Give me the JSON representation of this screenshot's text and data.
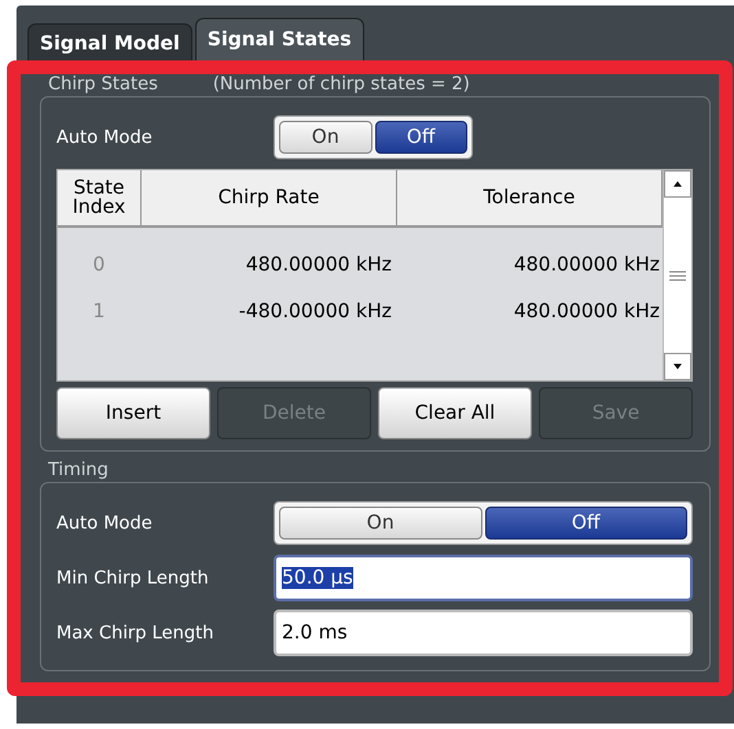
{
  "tabs": [
    {
      "label": "Signal Model",
      "selected": false
    },
    {
      "label": "Signal States",
      "selected": true
    }
  ],
  "chirp_states": {
    "title": "Chirp States",
    "count_label": "(Number of chirp states = 2)",
    "auto_mode": {
      "label": "Auto Mode",
      "options": [
        {
          "label": "On",
          "selected": false
        },
        {
          "label": "Off",
          "selected": true
        }
      ]
    },
    "table": {
      "columns": [
        "State Index",
        "Chirp Rate",
        "Tolerance"
      ],
      "rows": [
        [
          "0",
          "480.00000 kHz",
          "480.00000 kHz"
        ],
        [
          "1",
          "-480.00000 kHz",
          "480.00000 kHz"
        ]
      ]
    },
    "buttons": [
      {
        "label": "Insert",
        "disabled": false
      },
      {
        "label": "Delete",
        "disabled": true
      },
      {
        "label": "Clear All",
        "disabled": false
      },
      {
        "label": "Save",
        "disabled": true
      }
    ]
  },
  "timing": {
    "title": "Timing",
    "auto_mode": {
      "label": "Auto Mode",
      "options": [
        {
          "label": "On",
          "selected": false
        },
        {
          "label": "Off",
          "selected": true
        }
      ]
    },
    "fields": [
      {
        "label": "Min Chirp Length",
        "value": "50.0 µs",
        "focused": true
      },
      {
        "label": "Max Chirp Length",
        "value": "2.0 ms",
        "focused": false
      }
    ]
  }
}
